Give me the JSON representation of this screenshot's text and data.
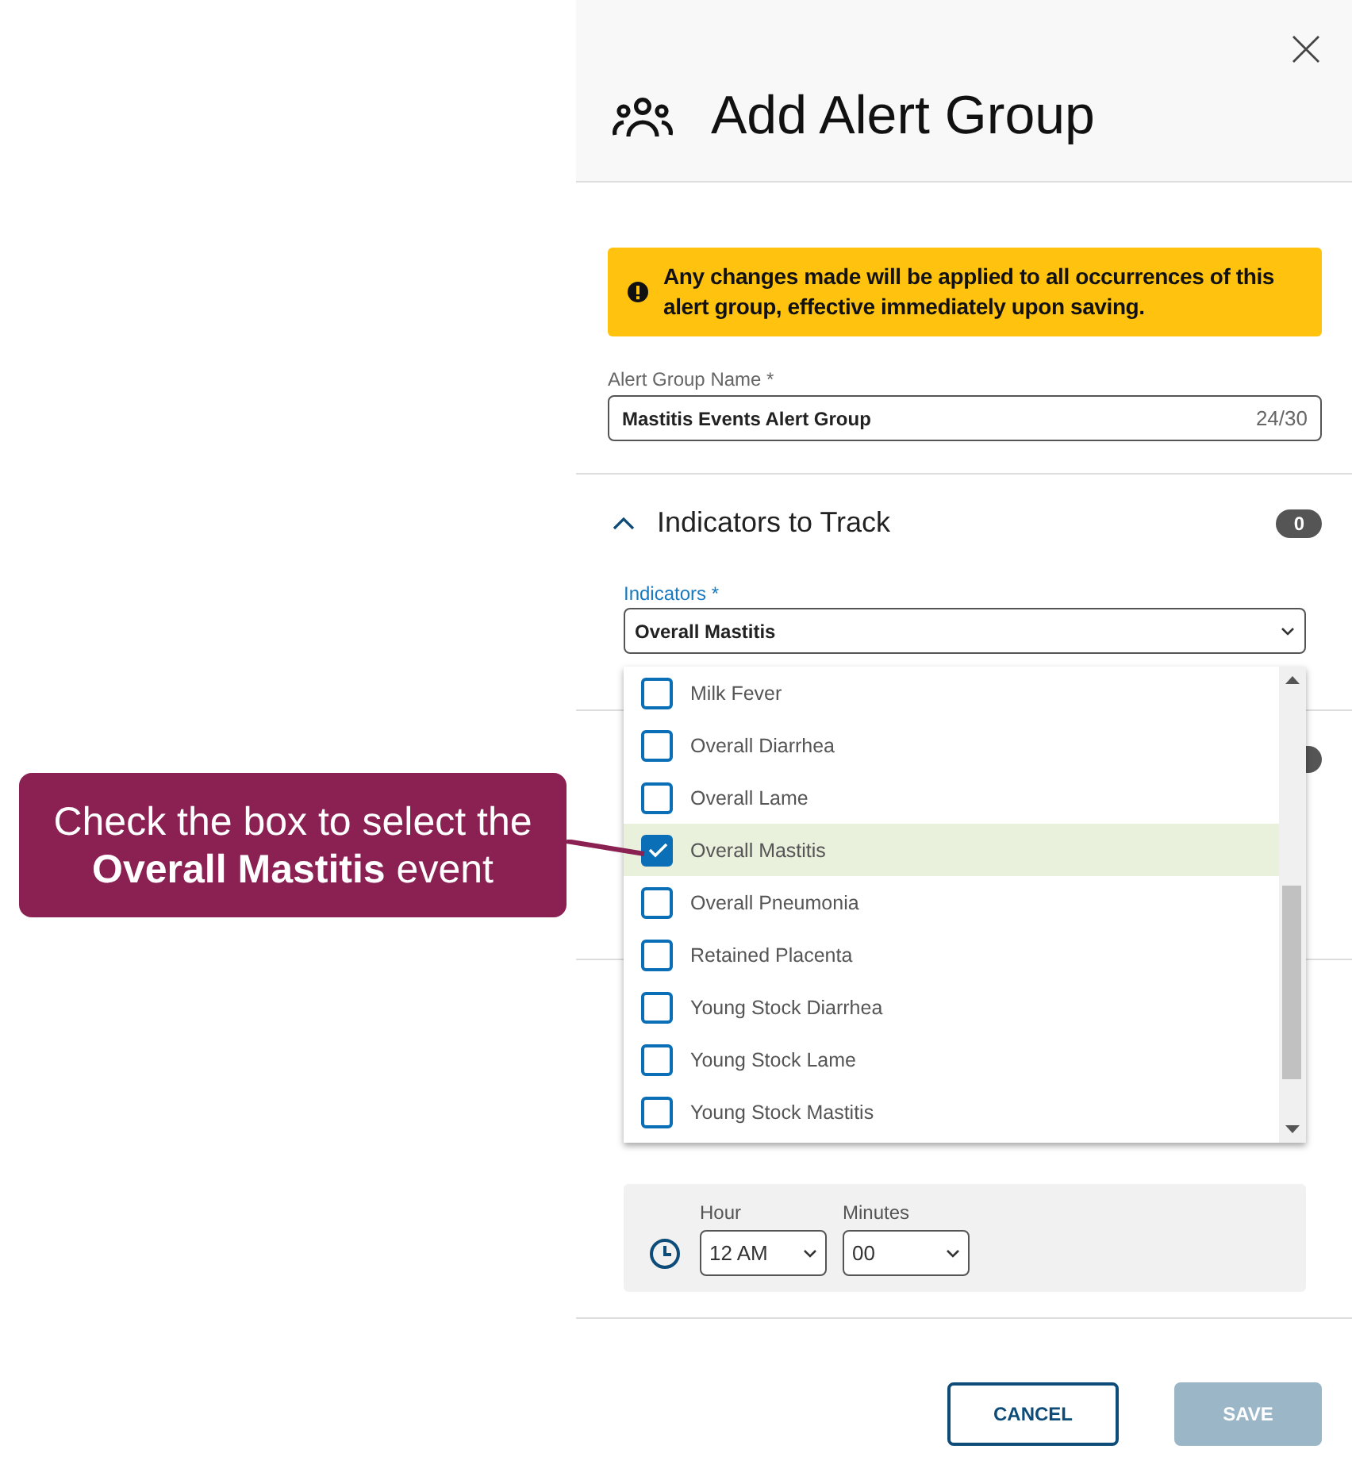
{
  "tooltip": {
    "text": "Check the box to select the **Overall Mastitis** event"
  },
  "dialog": {
    "title": "Add Alert Group",
    "warning": "Any changes made will be applied to all occurrences of this alert group, effective immediately upon saving.",
    "name_field": {
      "label": "Alert Group Name *",
      "value": "Mastitis Events Alert Group",
      "counter": "24/30"
    },
    "section": {
      "title": "Indicators to Track",
      "expanded": true,
      "count": "0"
    },
    "indicators": {
      "label": "Indicators *",
      "value": "Overall Mastitis",
      "open": true,
      "options": [
        {
          "label": "Milk Fever",
          "checked": false,
          "highlighted": false
        },
        {
          "label": "Overall Diarrhea",
          "checked": false,
          "highlighted": false
        },
        {
          "label": "Overall Lame",
          "checked": false,
          "highlighted": false
        },
        {
          "label": "Overall Mastitis",
          "checked": true,
          "highlighted": true
        },
        {
          "label": "Overall Pneumonia",
          "checked": false,
          "highlighted": false
        },
        {
          "label": "Retained Placenta",
          "checked": false,
          "highlighted": false
        },
        {
          "label": "Young Stock Diarrhea",
          "checked": false,
          "highlighted": false
        },
        {
          "label": "Young Stock Lame",
          "checked": false,
          "highlighted": false
        },
        {
          "label": "Young Stock Mastitis",
          "checked": false,
          "highlighted": false
        }
      ]
    },
    "time": {
      "hour_label": "Hour",
      "hour": "12 AM",
      "minutes_label": "Minutes",
      "minutes": "00"
    },
    "buttons": [
      {
        "label": "CANCEL",
        "kind": "secondary",
        "disabled": false
      },
      {
        "label": "SAVE",
        "kind": "primary",
        "disabled": true
      }
    ]
  }
}
